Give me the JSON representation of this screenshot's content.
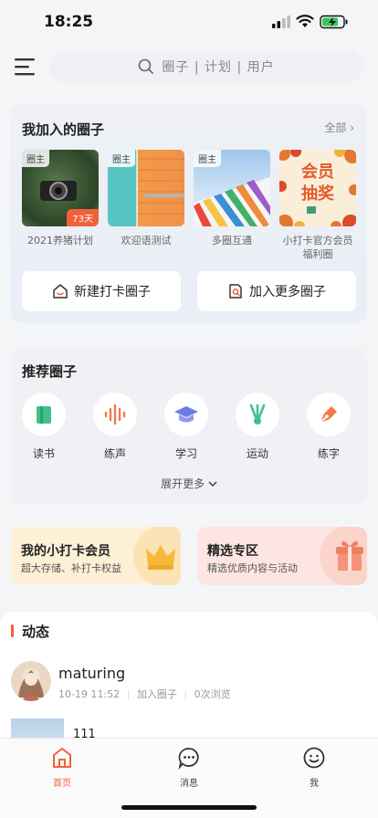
{
  "status_bar": {
    "time": "18:25"
  },
  "search": {
    "placeholder": "圈子 | 计划 | 用户"
  },
  "my_circles": {
    "title": "我加入的圈子",
    "all_link": "全部",
    "items": [
      {
        "name": "2021养猪计划",
        "owner_badge": "圈主",
        "days_badge": "73天"
      },
      {
        "name": "欢迎语测试",
        "owner_badge": "圈主"
      },
      {
        "name": "多圈互通",
        "owner_badge": "圈主"
      },
      {
        "name": "小打卡官方会员福利圈",
        "image_text_1": "会员",
        "image_text_2": "抽奖"
      }
    ],
    "create_button": "新建打卡圈子",
    "join_button": "加入更多圈子"
  },
  "recommend": {
    "title": "推荐圈子",
    "categories": [
      {
        "label": "读书",
        "icon": "book-icon"
      },
      {
        "label": "练声",
        "icon": "sound-wave-icon"
      },
      {
        "label": "学习",
        "icon": "graduation-cap-icon"
      },
      {
        "label": "运动",
        "icon": "shuttlecock-icon"
      },
      {
        "label": "练字",
        "icon": "pen-nib-icon"
      }
    ],
    "more": "展开更多"
  },
  "promos": {
    "member": {
      "title": "我的小打卡会员",
      "subtitle": "超大存储、补打卡权益",
      "icon": "crown-icon"
    },
    "featured": {
      "title": "精选专区",
      "subtitle": "精选优质内容与活动",
      "icon": "gift-icon"
    }
  },
  "feed": {
    "title": "动态",
    "post": {
      "username": "maturing",
      "time": "10-19 11:52",
      "action": "加入圈子",
      "views": "0次浏览",
      "text": "111"
    }
  },
  "tabbar": {
    "items": [
      {
        "label": "首页",
        "icon": "home-icon",
        "active": true
      },
      {
        "label": "消息",
        "icon": "message-icon",
        "active": false
      },
      {
        "label": "我",
        "icon": "smile-icon",
        "active": false
      }
    ]
  },
  "colors": {
    "accent": "#f2603a",
    "card_bg": "#eef0f4",
    "member_bg": "#fdf0d6",
    "featured_bg": "#fde6e1"
  }
}
